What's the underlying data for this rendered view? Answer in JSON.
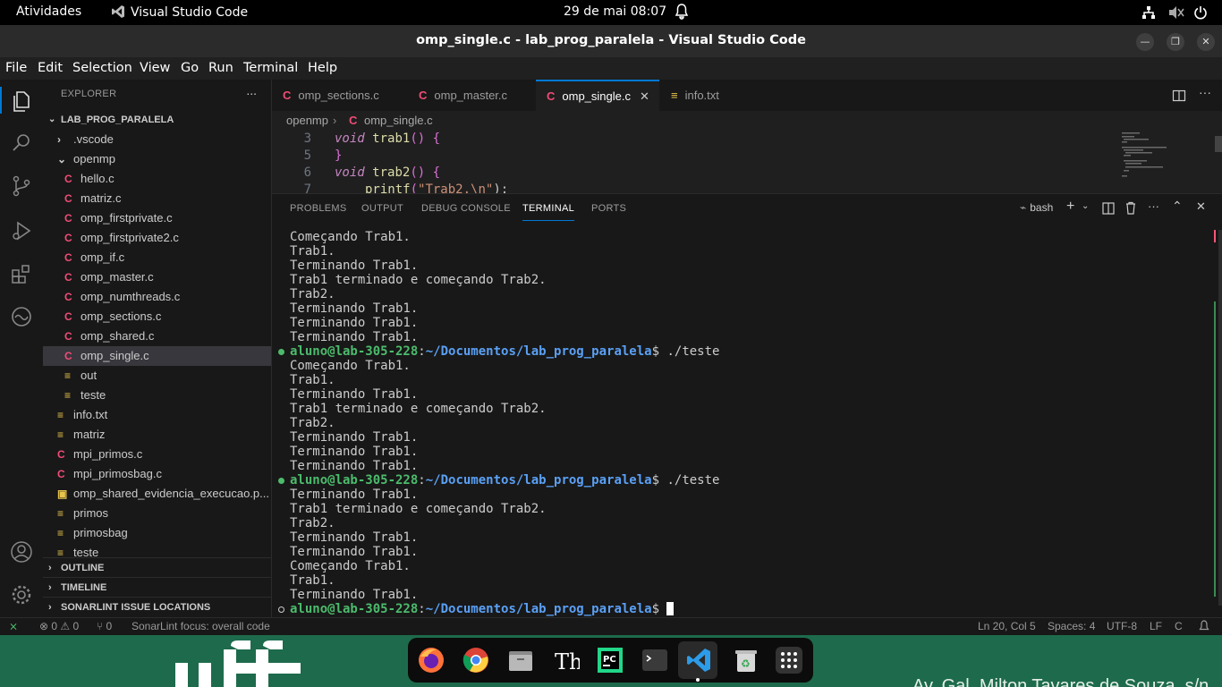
{
  "gnome": {
    "activities": "Atividades",
    "app": "Visual Studio Code",
    "clock": "29 de mai  08:07"
  },
  "window": {
    "title": "omp_single.c - lab_prog_paralela - Visual Studio Code"
  },
  "menu": [
    "File",
    "Edit",
    "Selection",
    "View",
    "Go",
    "Run",
    "Terminal",
    "Help"
  ],
  "explorer": {
    "header": "EXPLORER",
    "more": "...",
    "root": "LAB_PROG_PARALELA",
    "items": [
      {
        "label": ".vscode",
        "type": "folder-closed",
        "depth": 1
      },
      {
        "label": "openmp",
        "type": "folder-open",
        "depth": 1
      },
      {
        "label": "hello.c",
        "type": "c",
        "depth": 2
      },
      {
        "label": "matriz.c",
        "type": "c",
        "depth": 2
      },
      {
        "label": "omp_firstprivate.c",
        "type": "c",
        "depth": 2
      },
      {
        "label": "omp_firstprivate2.c",
        "type": "c",
        "depth": 2
      },
      {
        "label": "omp_if.c",
        "type": "c",
        "depth": 2
      },
      {
        "label": "omp_master.c",
        "type": "c",
        "depth": 2
      },
      {
        "label": "omp_numthreads.c",
        "type": "c",
        "depth": 2
      },
      {
        "label": "omp_sections.c",
        "type": "c",
        "depth": 2
      },
      {
        "label": "omp_shared.c",
        "type": "c",
        "depth": 2
      },
      {
        "label": "omp_single.c",
        "type": "c",
        "depth": 2,
        "selected": true
      },
      {
        "label": "out",
        "type": "txt",
        "depth": 2
      },
      {
        "label": "teste",
        "type": "txt",
        "depth": 2
      },
      {
        "label": "info.txt",
        "type": "txt",
        "depth": 1
      },
      {
        "label": "matriz",
        "type": "txt",
        "depth": 1
      },
      {
        "label": "mpi_primos.c",
        "type": "c",
        "depth": 1
      },
      {
        "label": "mpi_primosbag.c",
        "type": "c",
        "depth": 1
      },
      {
        "label": "omp_shared_evidencia_execucao.p...",
        "type": "pdf",
        "depth": 1
      },
      {
        "label": "primos",
        "type": "txt",
        "depth": 1
      },
      {
        "label": "primosbag",
        "type": "txt",
        "depth": 1
      },
      {
        "label": "teste",
        "type": "txt",
        "depth": 1
      }
    ],
    "sections": [
      "OUTLINE",
      "TIMELINE",
      "SONARLINT ISSUE LOCATIONS"
    ]
  },
  "tabs": [
    {
      "label": "omp_sections.c",
      "icon": "C"
    },
    {
      "label": "omp_master.c",
      "icon": "C"
    },
    {
      "label": "omp_single.c",
      "icon": "C",
      "active": true
    },
    {
      "label": "info.txt",
      "icon": "≡"
    }
  ],
  "breadcrumb": {
    "folder": "openmp",
    "file": "omp_single.c"
  },
  "code": {
    "lines": [
      {
        "num": "3",
        "kw": "void",
        "fn": "trab1",
        "rest": "() {"
      },
      {
        "num": "5",
        "text": "}"
      },
      {
        "num": "6",
        "kw": "void",
        "fn": "trab2",
        "rest": "() {"
      },
      {
        "num": "7",
        "call": "printf",
        "str": "\"Trab2.\\n\"",
        "tail": ");"
      }
    ]
  },
  "panel": {
    "tabs": [
      "PROBLEMS",
      "OUTPUT",
      "DEBUG CONSOLE",
      "TERMINAL",
      "PORTS"
    ],
    "active_tab": "TERMINAL",
    "shell": "bash"
  },
  "terminal": {
    "prompt_user": "aluno@lab-305-228",
    "prompt_path": "~/Documentos/lab_prog_paralela",
    "lines": [
      {
        "type": "out",
        "text": "Começando Trab1."
      },
      {
        "type": "out",
        "text": "Trab1."
      },
      {
        "type": "out",
        "text": "Terminando Trab1."
      },
      {
        "type": "out",
        "text": "Trab1 terminado e começando Trab2."
      },
      {
        "type": "out",
        "text": "Trab2."
      },
      {
        "type": "out",
        "text": "Terminando Trab1."
      },
      {
        "type": "out",
        "text": "Terminando Trab1."
      },
      {
        "type": "out",
        "text": "Terminando Trab1."
      },
      {
        "type": "prompt",
        "cmd": "./teste"
      },
      {
        "type": "out",
        "text": "Começando Trab1."
      },
      {
        "type": "out",
        "text": "Trab1."
      },
      {
        "type": "out",
        "text": "Terminando Trab1."
      },
      {
        "type": "out",
        "text": "Trab1 terminado e começando Trab2."
      },
      {
        "type": "out",
        "text": "Trab2."
      },
      {
        "type": "out",
        "text": "Terminando Trab1."
      },
      {
        "type": "out",
        "text": "Terminando Trab1."
      },
      {
        "type": "out",
        "text": "Terminando Trab1."
      },
      {
        "type": "prompt",
        "cmd": "./teste"
      },
      {
        "type": "out",
        "text": "Terminando Trab1."
      },
      {
        "type": "out",
        "text": "Trab1 terminado e começando Trab2."
      },
      {
        "type": "out",
        "text": "Trab2."
      },
      {
        "type": "out",
        "text": "Terminando Trab1."
      },
      {
        "type": "out",
        "text": "Terminando Trab1."
      },
      {
        "type": "out",
        "text": "Começando Trab1."
      },
      {
        "type": "out",
        "text": "Trab1."
      },
      {
        "type": "out",
        "text": "Terminando Trab1."
      },
      {
        "type": "prompt-current",
        "cmd": ""
      }
    ]
  },
  "status": {
    "problems": "⊗ 0 ⚠ 0",
    "ports": "⑂ 0",
    "sonarlint": "SonarLint focus: overall code",
    "position": "Ln 20, Col 5",
    "spaces": "Spaces: 4",
    "encoding": "UTF-8",
    "eol": "LF",
    "language": "C"
  },
  "desktop": {
    "address": "Av. Gal. Milton Tavares de Souza, s/n"
  },
  "dock": [
    "firefox",
    "chrome",
    "files",
    "typography",
    "pycharm",
    "terminal",
    "vscode",
    "trash",
    "app-grid"
  ],
  "colors": {
    "accent": "#0078d4",
    "c_icon": "#f14c76",
    "prompt_user": "#4cbb6c",
    "prompt_path": "#5aa0f5"
  }
}
